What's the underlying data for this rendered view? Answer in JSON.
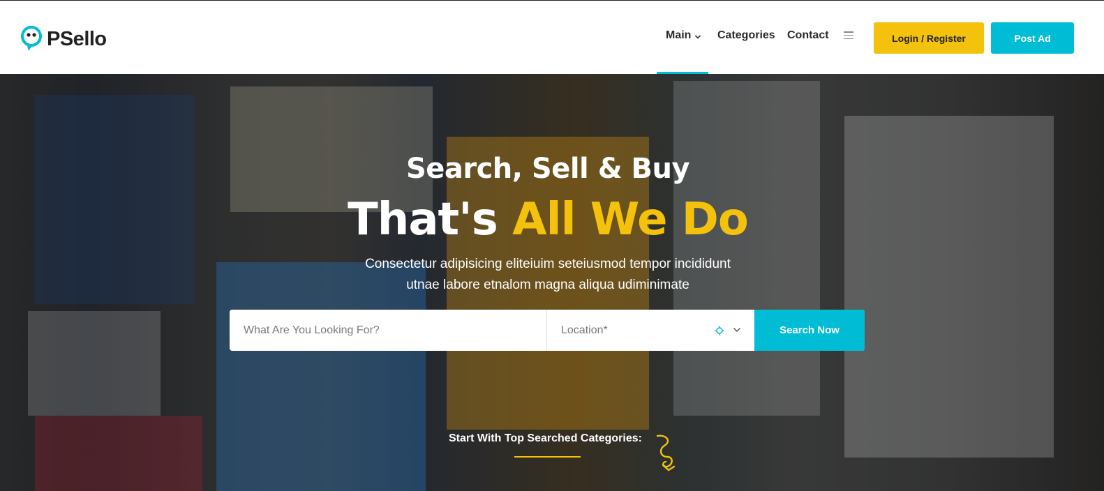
{
  "brand": {
    "name": "PSello",
    "accent": "#00bcd4",
    "highlight": "#f4c20d"
  },
  "nav": {
    "main_label": "Main",
    "categories_label": "Categories",
    "contact_label": "Contact",
    "menu_icon": "hamburger-icon"
  },
  "header_buttons": {
    "login_label": "Login / Register",
    "post_label": "Post Ad"
  },
  "hero": {
    "line1": "Search, Sell & Buy",
    "line2_white": "That's",
    "line2_accent": "All We Do",
    "subtitle_1": "Consectetur adipisicing eliteiuim seteiusmod tempor incididunt",
    "subtitle_2": "utnae labore etnalom magna aliqua udiminimate"
  },
  "search": {
    "query_placeholder": "What Are You Looking For?",
    "location_placeholder": "Location*",
    "button_label": "Search Now",
    "location_icon": "crosshair-icon",
    "dropdown_icon": "chevron-down-icon"
  },
  "categories": {
    "title": "Start With Top Searched Categories:",
    "decoration_icon": "squiggle-arrow-icon"
  }
}
